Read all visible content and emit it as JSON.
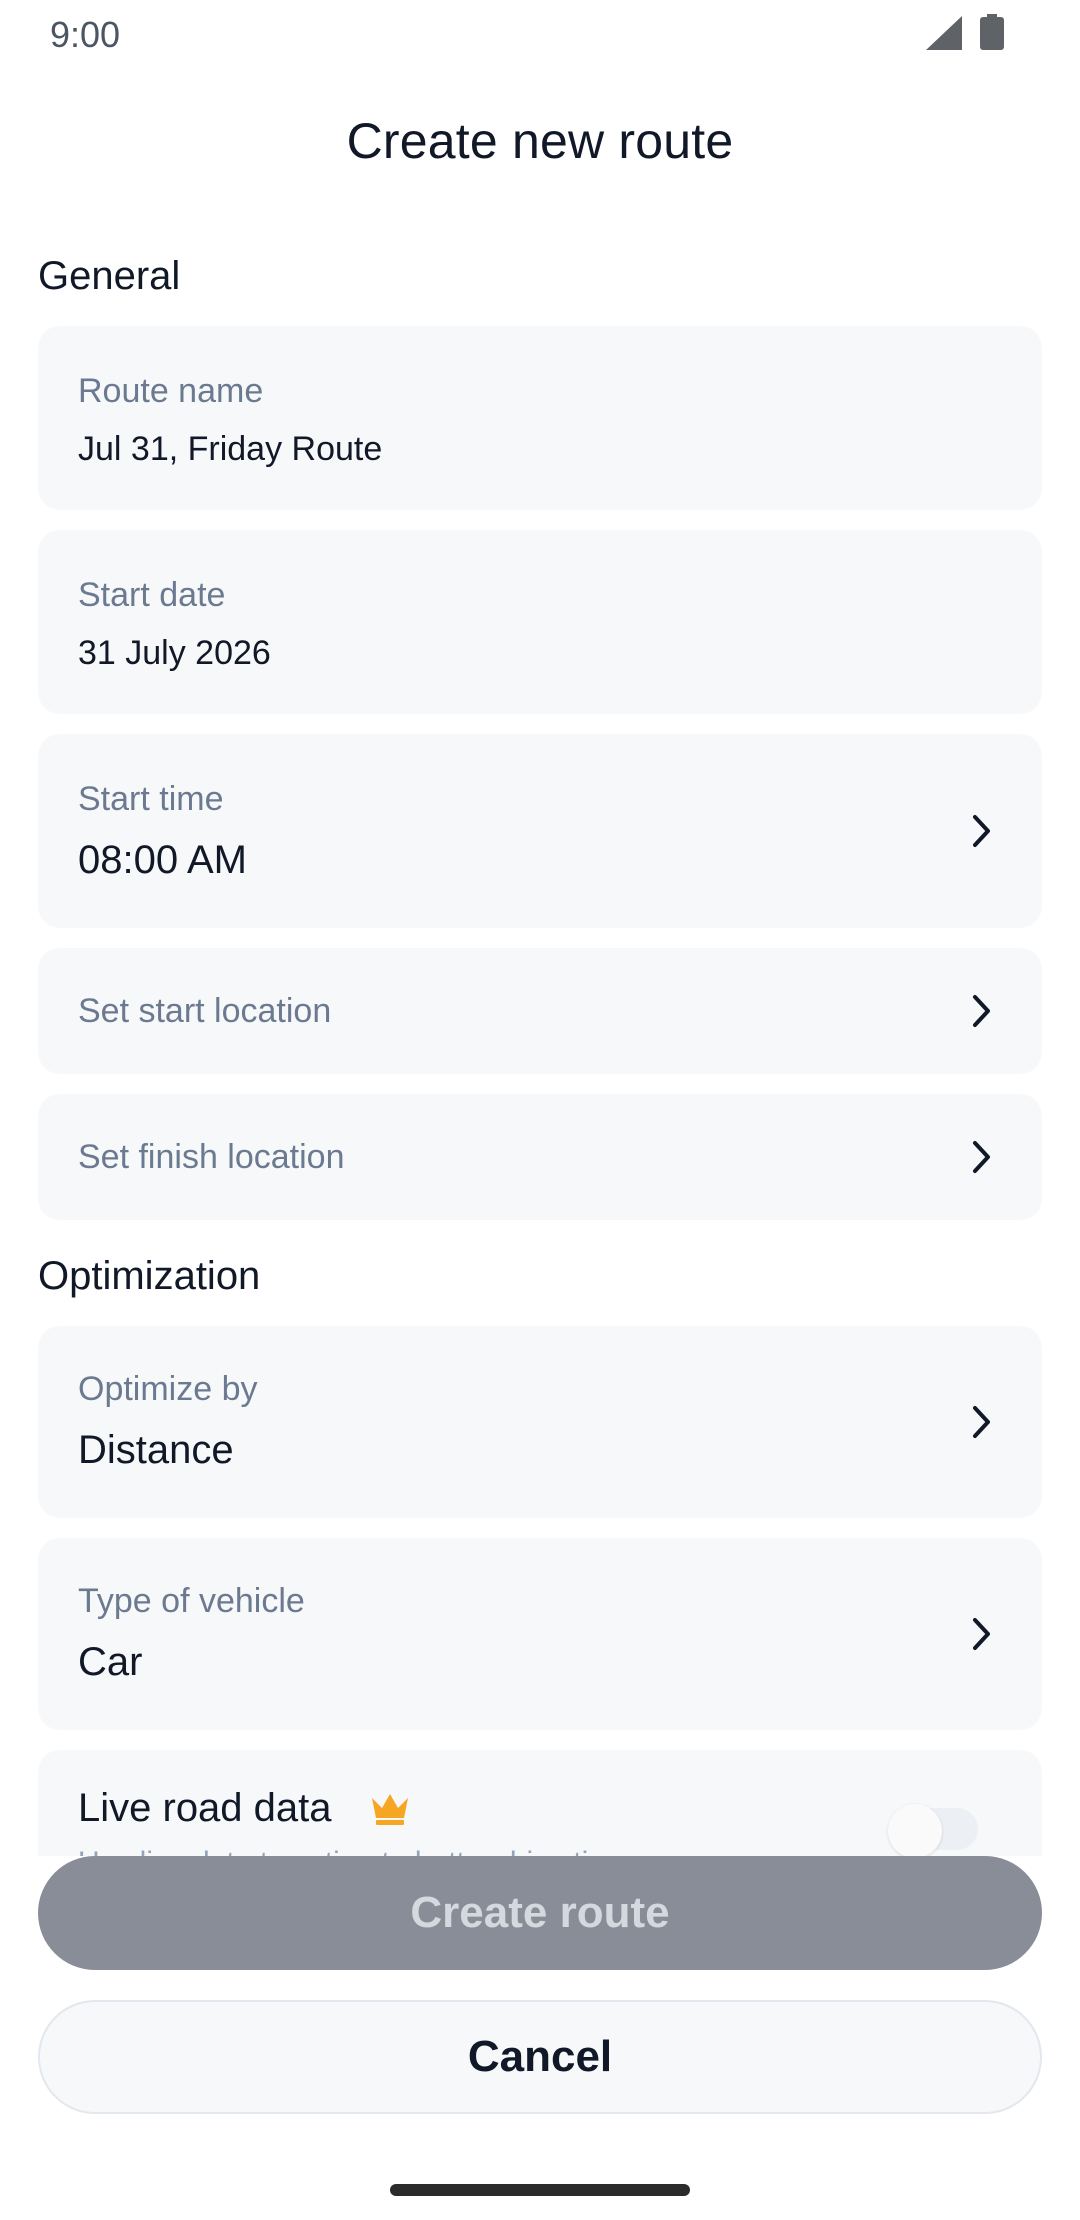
{
  "status_bar": {
    "time": "9:00"
  },
  "header": {
    "title": "Create new route"
  },
  "general": {
    "title": "General",
    "route_name": {
      "label": "Route name",
      "value": "Jul 31, Friday Route"
    },
    "start_date": {
      "label": "Start date",
      "value": "31 July 2026"
    },
    "start_time": {
      "label": "Start time",
      "value": "08:00 AM"
    },
    "start_location": {
      "placeholder": "Set start location"
    },
    "finish_location": {
      "placeholder": "Set finish location"
    }
  },
  "optimization": {
    "title": "Optimization",
    "optimize_by": {
      "label": "Optimize by",
      "value": "Distance"
    },
    "vehicle_type": {
      "label": "Type of vehicle",
      "value": "Car"
    },
    "live_road_data": {
      "label": "Live road data",
      "subtitle": "Use live data to estimate better drive times",
      "enabled": false
    }
  },
  "actions": {
    "create_label": "Create route",
    "cancel_label": "Cancel"
  },
  "icons": {
    "chevron": "chevron-right-icon",
    "premium": "crown-icon",
    "signal": "cellular-signal-icon",
    "battery": "battery-icon"
  },
  "colors": {
    "card_background": "#f7f8fa",
    "label": "#6b7a90",
    "premium_crown": "#f5a623",
    "disabled_button": "#898d98"
  }
}
